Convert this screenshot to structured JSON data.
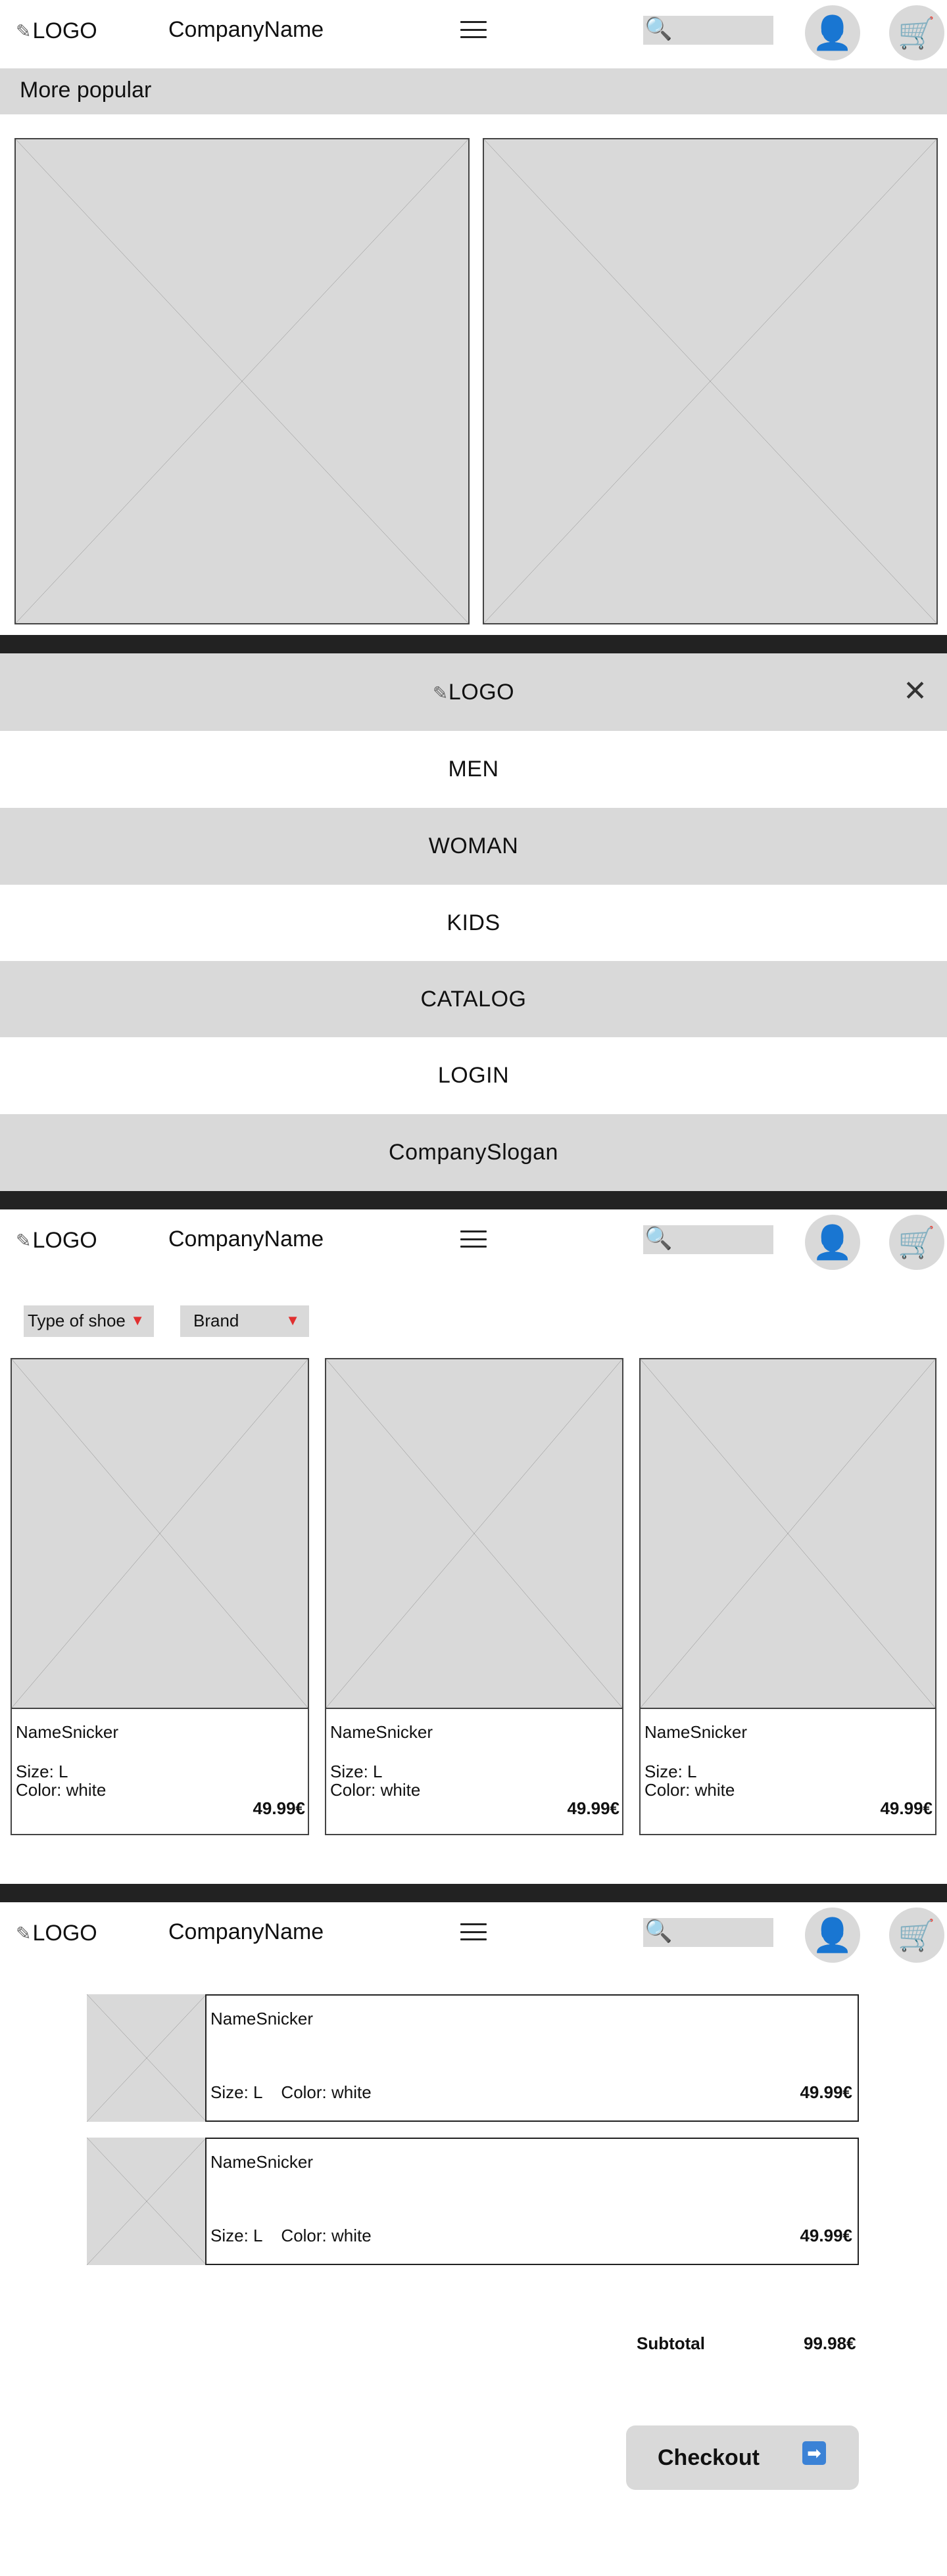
{
  "header": {
    "logo": "LOGO",
    "company": "CompanyName"
  },
  "home": {
    "popular_title": "More popular"
  },
  "nav_menu": {
    "logo": "LOGO",
    "items": [
      "MEN",
      "WOMAN",
      "KIDS",
      "CATALOG",
      "LOGIN"
    ],
    "slogan": "CompanySlogan"
  },
  "catalog": {
    "filters": [
      {
        "label": "Type of shoe"
      },
      {
        "label": "Brand"
      }
    ],
    "products": [
      {
        "name": "NameSnicker",
        "size": "Size: L",
        "color": "Color: white",
        "price": "49.99€"
      },
      {
        "name": "NameSnicker",
        "size": "Size: L",
        "color": "Color: white",
        "price": "49.99€"
      },
      {
        "name": "NameSnicker",
        "size": "Size: L",
        "color": "Color: white",
        "price": "49.99€"
      }
    ]
  },
  "cart": {
    "items": [
      {
        "name": "NameSnicker",
        "meta": "Size: L    Color: white",
        "price": "49.99€"
      },
      {
        "name": "NameSnicker",
        "meta": "Size: L    Color: white",
        "price": "49.99€"
      }
    ],
    "subtotal_label": "Subtotal",
    "subtotal_value": "99.98€",
    "checkout_label": "Checkout"
  }
}
